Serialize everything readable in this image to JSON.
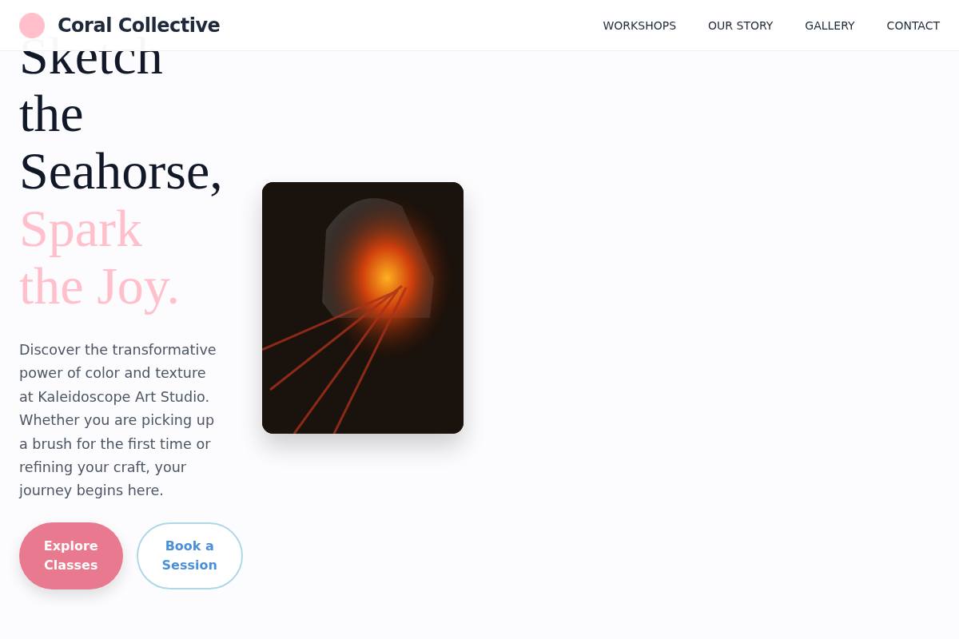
{
  "header": {
    "brand": "Coral Collective",
    "nav": [
      {
        "label": "WORKSHOPS"
      },
      {
        "label": "OUR STORY"
      },
      {
        "label": "GALLERY"
      },
      {
        "label": "CONTACT"
      }
    ]
  },
  "hero": {
    "heading": "Sketch the Seahorse,",
    "heading_accent": "Spark the Joy.",
    "body": "Discover the transformative power of color and texture at Kaleidoscope Art Studio. Whether you are picking up a brush for the first time or refining your craft, your journey begins here.",
    "buttons": [
      {
        "label": "Explore Classes",
        "kind": "primary"
      },
      {
        "label": "Book a Session",
        "kind": "outline"
      }
    ]
  }
}
